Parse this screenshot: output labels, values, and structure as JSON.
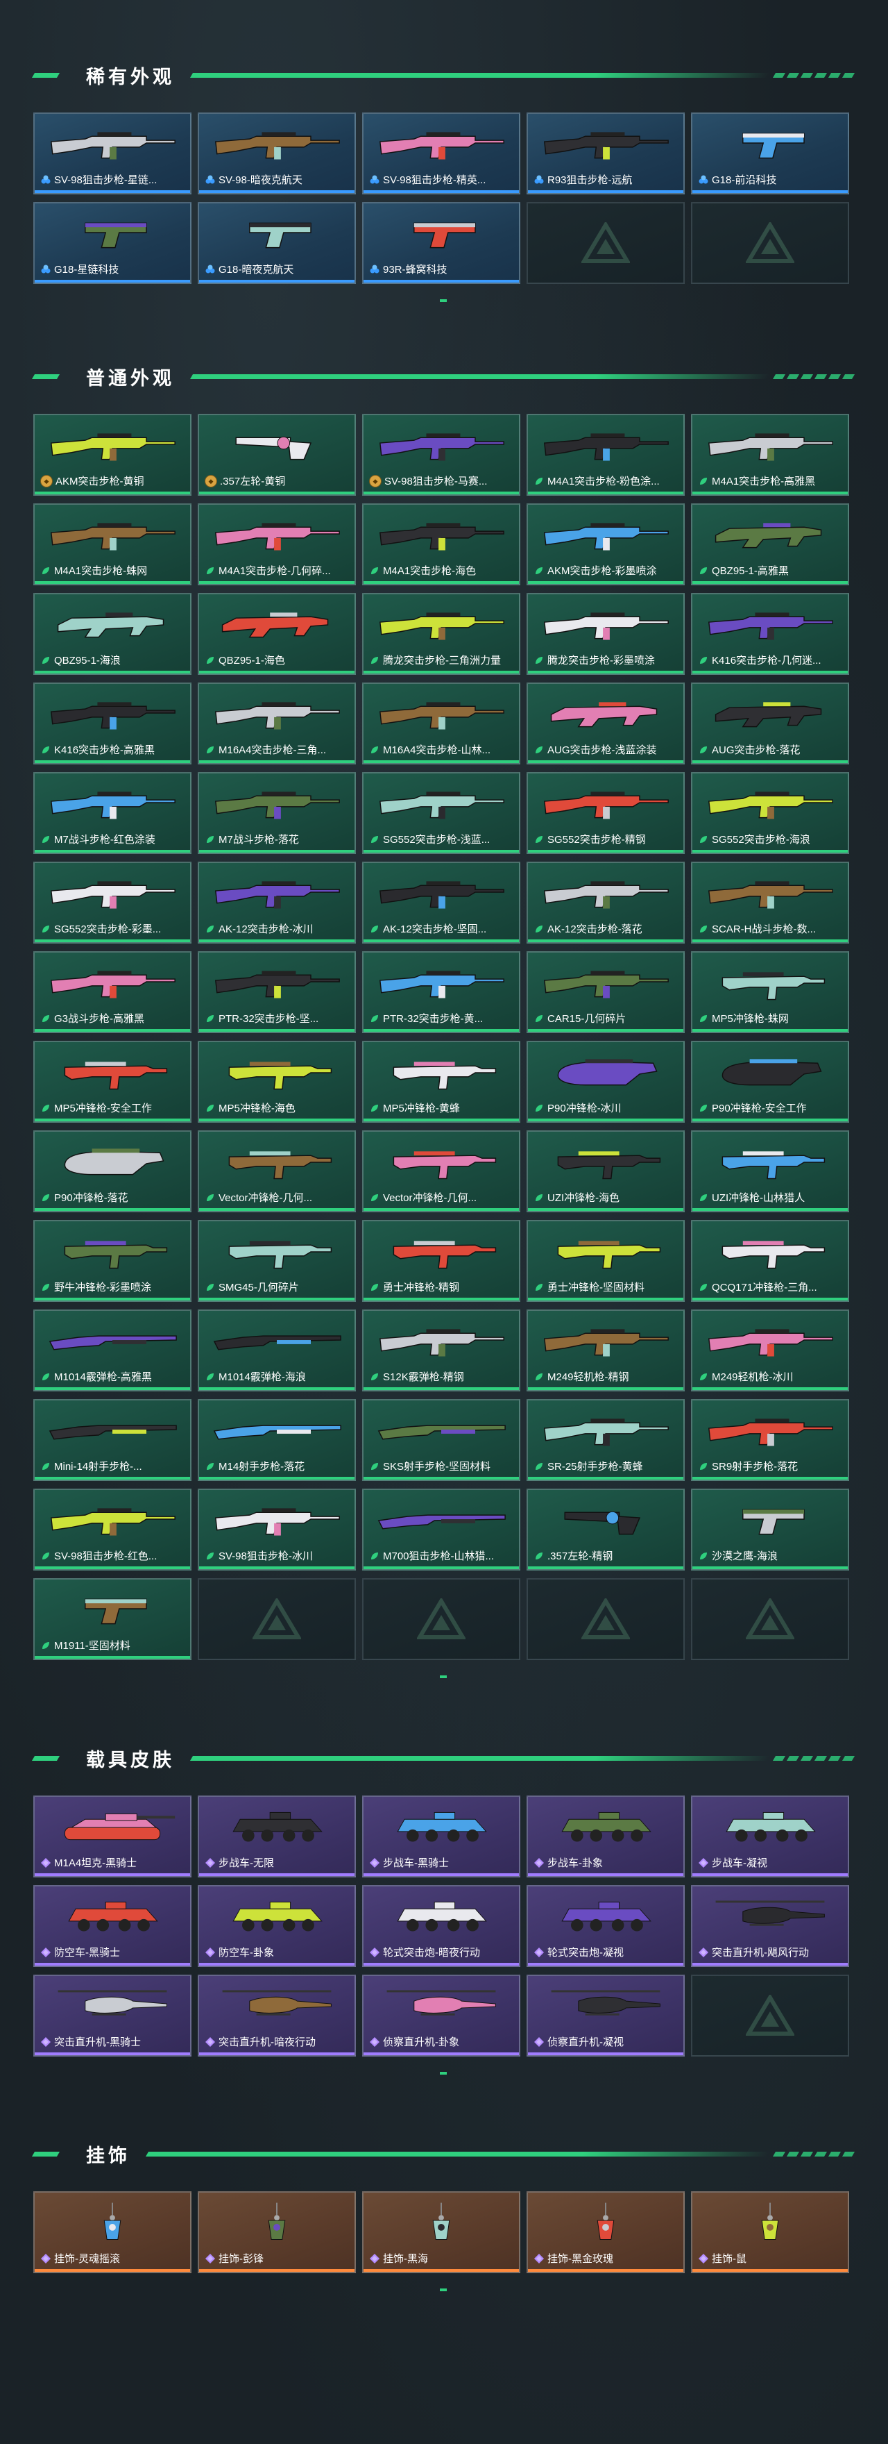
{
  "colors": {
    "accent": "#2fd07e",
    "rare": "#3a9bff",
    "common": "#2fd07e",
    "vehicle": "#a07cff",
    "pendant": "#ff8a3c"
  },
  "sections": [
    {
      "title": "稀有外观",
      "kind": "rare",
      "items": [
        {
          "label": "SV-98狙击步枪-星链...",
          "icon": "gem-icon",
          "art": "rifle"
        },
        {
          "label": "SV-98-暗夜克航天",
          "icon": "gem-icon",
          "art": "rifle"
        },
        {
          "label": "SV-98狙击步枪-精英...",
          "icon": "gem-icon",
          "art": "rifle"
        },
        {
          "label": "R93狙击步枪-远航",
          "icon": "gem-icon",
          "art": "rifle"
        },
        {
          "label": "G18-前沿科技",
          "icon": "gem-icon",
          "art": "pistol"
        },
        {
          "label": "G18-星链科技",
          "icon": "gem-icon",
          "art": "pistol"
        },
        {
          "label": "G18-暗夜克航天",
          "icon": "gem-icon",
          "art": "pistol"
        },
        {
          "label": "93R-蜂窝科技",
          "icon": "gem-icon",
          "art": "pistol"
        }
      ],
      "empties": 2
    },
    {
      "title": "普通外观",
      "kind": "common",
      "items": [
        {
          "label": "AKM突击步枪-黄铜",
          "icon": "medal-icon",
          "art": "rifle"
        },
        {
          "label": ".357左轮-黄铜",
          "icon": "medal-icon",
          "art": "revolver"
        },
        {
          "label": "SV-98狙击步枪-马赛...",
          "icon": "medal-icon",
          "art": "rifle"
        },
        {
          "label": "M4A1突击步枪-粉色涂...",
          "icon": "leaf-icon",
          "art": "rifle"
        },
        {
          "label": "M4A1突击步枪-高雅黑",
          "icon": "leaf-icon",
          "art": "rifle"
        },
        {
          "label": "M4A1突击步枪-蛛网",
          "icon": "leaf-icon",
          "art": "rifle"
        },
        {
          "label": "M4A1突击步枪-几何碎...",
          "icon": "leaf-icon",
          "art": "rifle"
        },
        {
          "label": "M4A1突击步枪-海色",
          "icon": "leaf-icon",
          "art": "rifle"
        },
        {
          "label": "AKM突击步枪-彩墨喷涂",
          "icon": "leaf-icon",
          "art": "rifle"
        },
        {
          "label": "QBZ95-1-高雅黑",
          "icon": "leaf-icon",
          "art": "bullpup"
        },
        {
          "label": "QBZ95-1-海浪",
          "icon": "leaf-icon",
          "art": "bullpup"
        },
        {
          "label": "QBZ95-1-海色",
          "icon": "leaf-icon",
          "art": "bullpup"
        },
        {
          "label": "腾龙突击步枪-三角洲力量",
          "icon": "leaf-icon",
          "art": "rifle"
        },
        {
          "label": "腾龙突击步枪-彩墨喷涂",
          "icon": "leaf-icon",
          "art": "rifle"
        },
        {
          "label": "K416突击步枪-几何迷...",
          "icon": "leaf-icon",
          "art": "rifle"
        },
        {
          "label": "K416突击步枪-高雅黑",
          "icon": "leaf-icon",
          "art": "rifle"
        },
        {
          "label": "M16A4突击步枪-三角...",
          "icon": "leaf-icon",
          "art": "rifle"
        },
        {
          "label": "M16A4突击步枪-山林...",
          "icon": "leaf-icon",
          "art": "rifle"
        },
        {
          "label": "AUG突击步枪-浅蓝涂装",
          "icon": "leaf-icon",
          "art": "bullpup"
        },
        {
          "label": "AUG突击步枪-落花",
          "icon": "leaf-icon",
          "art": "bullpup"
        },
        {
          "label": "M7战斗步枪-红色涂装",
          "icon": "leaf-icon",
          "art": "rifle"
        },
        {
          "label": "M7战斗步枪-落花",
          "icon": "leaf-icon",
          "art": "rifle"
        },
        {
          "label": "SG552突击步枪-浅蓝...",
          "icon": "leaf-icon",
          "art": "rifle"
        },
        {
          "label": "SG552突击步枪-精钢",
          "icon": "leaf-icon",
          "art": "rifle"
        },
        {
          "label": "SG552突击步枪-海浪",
          "icon": "leaf-icon",
          "art": "rifle"
        },
        {
          "label": "SG552突击步枪-彩墨...",
          "icon": "leaf-icon",
          "art": "rifle"
        },
        {
          "label": "AK-12突击步枪-冰川",
          "icon": "leaf-icon",
          "art": "rifle"
        },
        {
          "label": "AK-12突击步枪-坚固...",
          "icon": "leaf-icon",
          "art": "rifle"
        },
        {
          "label": "AK-12突击步枪-落花",
          "icon": "leaf-icon",
          "art": "rifle"
        },
        {
          "label": "SCAR-H战斗步枪-数...",
          "icon": "leaf-icon",
          "art": "rifle"
        },
        {
          "label": "G3战斗步枪-高雅黑",
          "icon": "leaf-icon",
          "art": "rifle"
        },
        {
          "label": "PTR-32突击步枪-坚...",
          "icon": "leaf-icon",
          "art": "rifle"
        },
        {
          "label": "PTR-32突击步枪-黄...",
          "icon": "leaf-icon",
          "art": "rifle"
        },
        {
          "label": "CAR15-几何碎片",
          "icon": "leaf-icon",
          "art": "rifle"
        },
        {
          "label": "MP5冲锋枪-蛛网",
          "icon": "leaf-icon",
          "art": "smg"
        },
        {
          "label": "MP5冲锋枪-安全工作",
          "icon": "leaf-icon",
          "art": "smg"
        },
        {
          "label": "MP5冲锋枪-海色",
          "icon": "leaf-icon",
          "art": "smg"
        },
        {
          "label": "MP5冲锋枪-黄蜂",
          "icon": "leaf-icon",
          "art": "smg"
        },
        {
          "label": "P90冲锋枪-冰川",
          "icon": "leaf-icon",
          "art": "p90"
        },
        {
          "label": "P90冲锋枪-安全工作",
          "icon": "leaf-icon",
          "art": "p90"
        },
        {
          "label": "P90冲锋枪-落花",
          "icon": "leaf-icon",
          "art": "p90"
        },
        {
          "label": "Vector冲锋枪-几何...",
          "icon": "leaf-icon",
          "art": "smg"
        },
        {
          "label": "Vector冲锋枪-几何...",
          "icon": "leaf-icon",
          "art": "smg"
        },
        {
          "label": "UZI冲锋枪-海色",
          "icon": "leaf-icon",
          "art": "smg"
        },
        {
          "label": "UZI冲锋枪-山林猎人",
          "icon": "leaf-icon",
          "art": "smg"
        },
        {
          "label": "野牛冲锋枪-彩墨喷涂",
          "icon": "leaf-icon",
          "art": "smg"
        },
        {
          "label": "SMG45-几何碎片",
          "icon": "leaf-icon",
          "art": "smg"
        },
        {
          "label": "勇士冲锋枪-精钢",
          "icon": "leaf-icon",
          "art": "smg"
        },
        {
          "label": "勇士冲锋枪-坚固材料",
          "icon": "leaf-icon",
          "art": "smg"
        },
        {
          "label": "QCQ171冲锋枪-三角...",
          "icon": "leaf-icon",
          "art": "smg"
        },
        {
          "label": "M1014霰弹枪-高雅黑",
          "icon": "leaf-icon",
          "art": "shotgun"
        },
        {
          "label": "M1014霰弹枪-海浪",
          "icon": "leaf-icon",
          "art": "shotgun"
        },
        {
          "label": "S12K霰弹枪-精钢",
          "icon": "leaf-icon",
          "art": "rifle"
        },
        {
          "label": "M249轻机枪-精钢",
          "icon": "leaf-icon",
          "art": "rifle"
        },
        {
          "label": "M249轻机枪-冰川",
          "icon": "leaf-icon",
          "art": "rifle"
        },
        {
          "label": "Mini-14射手步枪-...",
          "icon": "leaf-icon",
          "art": "shotgun"
        },
        {
          "label": "M14射手步枪-落花",
          "icon": "leaf-icon",
          "art": "shotgun"
        },
        {
          "label": "SKS射手步枪-坚固材料",
          "icon": "leaf-icon",
          "art": "shotgun"
        },
        {
          "label": "SR-25射手步枪-黄蜂",
          "icon": "leaf-icon",
          "art": "rifle"
        },
        {
          "label": "SR9射手步枪-落花",
          "icon": "leaf-icon",
          "art": "rifle"
        },
        {
          "label": "SV-98狙击步枪-红色...",
          "icon": "leaf-icon",
          "art": "rifle"
        },
        {
          "label": "SV-98狙击步枪-冰川",
          "icon": "leaf-icon",
          "art": "rifle"
        },
        {
          "label": "M700狙击步枪-山林猎...",
          "icon": "leaf-icon",
          "art": "shotgun"
        },
        {
          "label": ".357左轮-精钢",
          "icon": "leaf-icon",
          "art": "revolver"
        },
        {
          "label": "沙漠之鹰-海浪",
          "icon": "leaf-icon",
          "art": "pistol"
        },
        {
          "label": "M1911-坚固材料",
          "icon": "leaf-icon",
          "art": "pistol"
        }
      ],
      "empties": 4
    },
    {
      "title": "载具皮肤",
      "kind": "vehicle",
      "items": [
        {
          "label": "M1A4坦克-黑骑士",
          "icon": "diamond-icon",
          "art": "tank"
        },
        {
          "label": "步战车-无限",
          "icon": "diamond-icon",
          "art": "apc"
        },
        {
          "label": "步战车-黑骑士",
          "icon": "diamond-icon",
          "art": "apc"
        },
        {
          "label": "步战车-卦象",
          "icon": "diamond-icon",
          "art": "apc"
        },
        {
          "label": "步战车-凝视",
          "icon": "diamond-icon",
          "art": "apc"
        },
        {
          "label": "防空车-黑骑士",
          "icon": "diamond-icon",
          "art": "apc"
        },
        {
          "label": "防空车-卦象",
          "icon": "diamond-icon",
          "art": "apc"
        },
        {
          "label": "轮式突击炮-暗夜行动",
          "icon": "diamond-icon",
          "art": "apc"
        },
        {
          "label": "轮式突击炮-凝视",
          "icon": "diamond-icon",
          "art": "apc"
        },
        {
          "label": "突击直升机-飓风行动",
          "icon": "diamond-icon",
          "art": "heli"
        },
        {
          "label": "突击直升机-黑骑士",
          "icon": "diamond-icon",
          "art": "heli"
        },
        {
          "label": "突击直升机-暗夜行动",
          "icon": "diamond-icon",
          "art": "heli"
        },
        {
          "label": "侦察直升机-卦象",
          "icon": "diamond-icon",
          "art": "heli"
        },
        {
          "label": "侦察直升机-凝视",
          "icon": "diamond-icon",
          "art": "heli"
        }
      ],
      "empties": 1
    },
    {
      "title": "挂饰",
      "kind": "pendant",
      "items": [
        {
          "label": "挂饰-灵魂摇滚",
          "icon": "diamond-icon",
          "art": "charm"
        },
        {
          "label": "挂饰-彭锋",
          "icon": "diamond-icon",
          "art": "charm"
        },
        {
          "label": "挂饰-黑海",
          "icon": "diamond-icon",
          "art": "charm"
        },
        {
          "label": "挂饰-黑金玫瑰",
          "icon": "diamond-icon",
          "art": "charm"
        },
        {
          "label": "挂饰-鼠",
          "icon": "diamond-icon",
          "art": "charm"
        }
      ],
      "empties": 0
    }
  ]
}
